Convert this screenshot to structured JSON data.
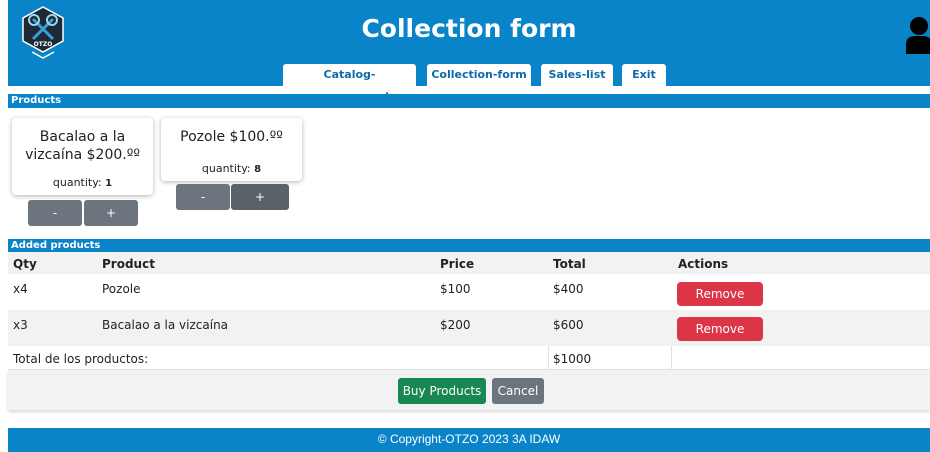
{
  "header": {
    "title": "Collection form",
    "logo_text": "OTZO",
    "logo_icon": "crossed-rackets-logo",
    "user_icon": "user-icon"
  },
  "nav": {
    "items": [
      {
        "label": "Catalog-management"
      },
      {
        "label": "Collection-form"
      },
      {
        "label": "Sales-list"
      },
      {
        "label": "Exit"
      }
    ]
  },
  "products_section": {
    "title": "Products",
    "cards": [
      {
        "name": "Bacalao a la vizcaína $200.ºº",
        "quantity_label": "quantity:",
        "quantity": "1",
        "minus": "-",
        "plus": "+"
      },
      {
        "name": "Pozole $100.ºº",
        "quantity_label": "quantity:",
        "quantity": "8",
        "minus": "-",
        "plus": "+"
      }
    ]
  },
  "added_section": {
    "title": "Added products",
    "columns": [
      "Qty",
      "Product",
      "Price",
      "Total",
      "Actions"
    ],
    "rows": [
      {
        "qty": "x4",
        "product": "Pozole",
        "price": "$100",
        "total": "$400",
        "action": "Remove"
      },
      {
        "qty": "x3",
        "product": "Bacalao a la vizcaína",
        "price": "$200",
        "total": "$600",
        "action": "Remove"
      }
    ],
    "total_label": "Total de los productos:",
    "total_value": "$1000"
  },
  "actions": {
    "buy": "Buy Products",
    "cancel": "Cancel"
  },
  "footer": {
    "copyright": "© Copyright-OTZO 2023 3A IDAW"
  },
  "colors": {
    "primary": "#0a84c8",
    "remove": "#dc3545",
    "buy": "#198754",
    "secondary": "#6c757d"
  }
}
